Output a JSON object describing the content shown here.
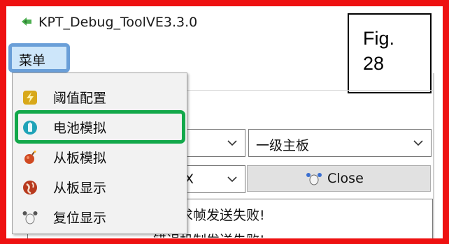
{
  "window": {
    "title": "KPT_Debug_ToolVE3.3.0",
    "app_icon": "gear-arrows-icon"
  },
  "menubar": {
    "root_label": "菜单"
  },
  "figure": {
    "label": "Fig.\n28"
  },
  "menu": {
    "items": [
      {
        "label": "阈值配置",
        "icon": "lightning-icon",
        "color": "#d8a81a"
      },
      {
        "label": "电池模拟",
        "icon": "battery-icon",
        "color": "#1fa3b8"
      },
      {
        "label": "从板模拟",
        "icon": "bomb-icon",
        "color": "#d04a22"
      },
      {
        "label": "从板显示",
        "icon": "globe-icon",
        "color": "#b83a1e"
      },
      {
        "label": "复位显示",
        "icon": "reset-icon",
        "color": "#555555"
      }
    ],
    "highlighted_index": 1,
    "highlight_color": "#12a84a"
  },
  "content": {
    "combo_left_value": "",
    "combo_right_value": "一级主板",
    "combo_left2_value": "X",
    "close_button_label": "Close",
    "log_line": "帮请求帧发送失败!",
    "log_line_cut": "错误机制发送失败!"
  },
  "colors": {
    "frame": "#ee1111",
    "menu_root_border": "#6a9fd8",
    "menu_root_fill": "#cde6fa"
  }
}
